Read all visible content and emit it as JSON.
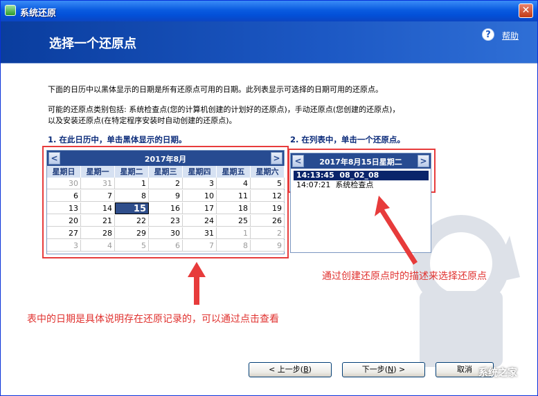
{
  "window": {
    "title": "系统还原",
    "close_glyph": "✕"
  },
  "header": {
    "title": "选择一个还原点",
    "help_label": "帮助",
    "help_glyph": "?"
  },
  "text": {
    "intro": "下面的日历中以黑体显示的日期是所有还原点可用的日期。此列表显示可选择的日期可用的还原点。",
    "categories_line1": "可能的还原点类别包括: 系统检查点(您的计算机创建的计划好的还原点)，手动还原点(您创建的还原点)，",
    "categories_line2": "以及安装还原点(在特定程序安装时自动创建的还原点)。",
    "step1": "1. 在此日历中，单击黑体显示的日期。",
    "step2": "2. 在列表中，单击一个还原点。"
  },
  "calendar": {
    "month_title": "2017年8月",
    "prev_glyph": "<",
    "next_glyph": ">",
    "weekdays": [
      "星期日",
      "星期一",
      "星期二",
      "星期三",
      "星期四",
      "星期五",
      "星期六"
    ],
    "weeks": [
      [
        "30",
        "31",
        "1",
        "2",
        "3",
        "4",
        "5"
      ],
      [
        "6",
        "7",
        "8",
        "9",
        "10",
        "11",
        "12"
      ],
      [
        "13",
        "14",
        "15",
        "16",
        "17",
        "18",
        "19"
      ],
      [
        "20",
        "21",
        "22",
        "23",
        "24",
        "25",
        "26"
      ],
      [
        "27",
        "28",
        "29",
        "30",
        "31",
        "1",
        "2"
      ],
      [
        "3",
        "4",
        "5",
        "6",
        "7",
        "8",
        "9"
      ]
    ],
    "selected_day": "15"
  },
  "restore_points": {
    "date_title": "2017年8月15日星期二",
    "prev_glyph": "<",
    "next_glyph": ">",
    "items": [
      {
        "time": "14:13:45",
        "description": "08_02_08"
      },
      {
        "time": "14:07:21",
        "description": "系统检查点"
      }
    ]
  },
  "annotations": {
    "right_note": "通过创建还原点时的描述来选择还原点",
    "left_note": "表中的日期是具体说明存在还原记录的，可以通过点击查看",
    "color": "#e0322f"
  },
  "buttons": {
    "back_label": "< 上一步(",
    "back_key": "B",
    "back_tail": ")",
    "next_label": "下一步(",
    "next_key": "N",
    "next_tail": ") >",
    "cancel_label": "取消"
  },
  "watermark_text": "系统之家"
}
